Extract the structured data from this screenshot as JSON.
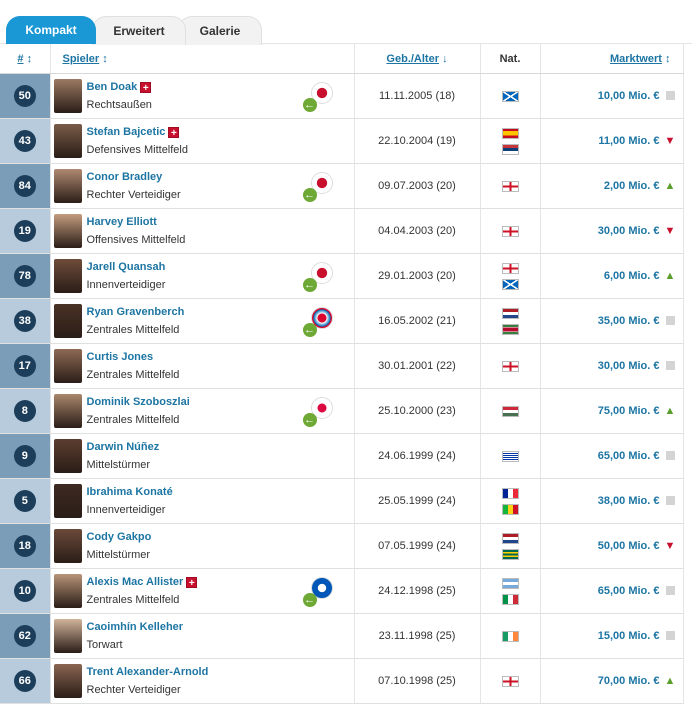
{
  "tabs": [
    {
      "label": "Kompakt",
      "active": true
    },
    {
      "label": "Erweitert",
      "active": false
    },
    {
      "label": "Galerie",
      "active": false
    }
  ],
  "columns": {
    "number": "#",
    "player": "Spieler",
    "birth_age": "Geb./Alter",
    "nationality": "Nat.",
    "market_value": "Marktwert"
  },
  "sort_icons": {
    "number": "↕",
    "player": "↕",
    "birth_age": "↓",
    "market_value": "↕"
  },
  "colors": {
    "accent": "#1a97d5",
    "badge": "#1d3e5a",
    "link": "#1d75a3",
    "trend_up": "#5a9e2c",
    "trend_down": "#c8102e",
    "injury": "#c8102e"
  },
  "players": [
    {
      "number": "50",
      "name": "Ben Doak",
      "injured": true,
      "position": "Rechtsaußen",
      "loan_club": "liverpool-crest-icon",
      "birth": "11.11.2005 (18)",
      "nationalities": [
        "scotland"
      ],
      "value": "10,00 Mio. €",
      "trend": "flat"
    },
    {
      "number": "43",
      "name": "Stefan Bajcetic",
      "injured": true,
      "position": "Defensives Mittelfeld",
      "loan_club": null,
      "birth": "22.10.2004 (19)",
      "nationalities": [
        "spain",
        "serbia"
      ],
      "value": "11,00 Mio. €",
      "trend": "down"
    },
    {
      "number": "84",
      "name": "Conor Bradley",
      "injured": false,
      "position": "Rechter Verteidiger",
      "loan_club": "liverpool-crest-icon",
      "birth": "09.07.2003 (20)",
      "nationalities": [
        "england"
      ],
      "value": "2,00 Mio. €",
      "trend": "up"
    },
    {
      "number": "19",
      "name": "Harvey Elliott",
      "injured": false,
      "position": "Offensives Mittelfeld",
      "loan_club": null,
      "birth": "04.04.2003 (20)",
      "nationalities": [
        "england"
      ],
      "value": "30,00 Mio. €",
      "trend": "down"
    },
    {
      "number": "78",
      "name": "Jarell Quansah",
      "injured": false,
      "position": "Innenverteidiger",
      "loan_club": "liverpool-crest-icon",
      "birth": "29.01.2003 (20)",
      "nationalities": [
        "england",
        "scotland"
      ],
      "value": "6,00 Mio. €",
      "trend": "up"
    },
    {
      "number": "38",
      "name": "Ryan Gravenberch",
      "injured": false,
      "position": "Zentrales Mittelfeld",
      "loan_club": "bayern-crest-icon",
      "birth": "16.05.2002 (21)",
      "nationalities": [
        "netherlands",
        "suriname"
      ],
      "value": "35,00 Mio. €",
      "trend": "flat"
    },
    {
      "number": "17",
      "name": "Curtis Jones",
      "injured": false,
      "position": "Zentrales Mittelfeld",
      "loan_club": null,
      "birth": "30.01.2001 (22)",
      "nationalities": [
        "england"
      ],
      "value": "30,00 Mio. €",
      "trend": "flat"
    },
    {
      "number": "8",
      "name": "Dominik Szoboszlai",
      "injured": false,
      "position": "Zentrales Mittelfeld",
      "loan_club": "leipzig-crest-icon",
      "birth": "25.10.2000 (23)",
      "nationalities": [
        "hungary"
      ],
      "value": "75,00 Mio. €",
      "trend": "up"
    },
    {
      "number": "9",
      "name": "Darwin Núñez",
      "injured": false,
      "position": "Mittelstürmer",
      "loan_club": null,
      "birth": "24.06.1999 (24)",
      "nationalities": [
        "uruguay"
      ],
      "value": "65,00 Mio. €",
      "trend": "flat"
    },
    {
      "number": "5",
      "name": "Ibrahima Konaté",
      "injured": false,
      "position": "Innenverteidiger",
      "loan_club": null,
      "birth": "25.05.1999 (24)",
      "nationalities": [
        "france",
        "mali"
      ],
      "value": "38,00 Mio. €",
      "trend": "flat"
    },
    {
      "number": "18",
      "name": "Cody Gakpo",
      "injured": false,
      "position": "Mittelstürmer",
      "loan_club": null,
      "birth": "07.05.1999 (24)",
      "nationalities": [
        "netherlands",
        "togo"
      ],
      "value": "50,00 Mio. €",
      "trend": "down"
    },
    {
      "number": "10",
      "name": "Alexis Mac Allister",
      "injured": true,
      "position": "Zentrales Mittelfeld",
      "loan_club": "brighton-crest-icon",
      "birth": "24.12.1998 (25)",
      "nationalities": [
        "argentina",
        "italy"
      ],
      "value": "65,00 Mio. €",
      "trend": "flat"
    },
    {
      "number": "62",
      "name": "Caoimhín Kelleher",
      "injured": false,
      "position": "Torwart",
      "loan_club": null,
      "birth": "23.11.1998 (25)",
      "nationalities": [
        "ireland"
      ],
      "value": "15,00 Mio. €",
      "trend": "flat"
    },
    {
      "number": "66",
      "name": "Trent Alexander-Arnold",
      "injured": false,
      "position": "Rechter Verteidiger",
      "loan_club": null,
      "birth": "07.10.1998 (25)",
      "nationalities": [
        "england"
      ],
      "value": "70,00 Mio. €",
      "trend": "up"
    }
  ]
}
